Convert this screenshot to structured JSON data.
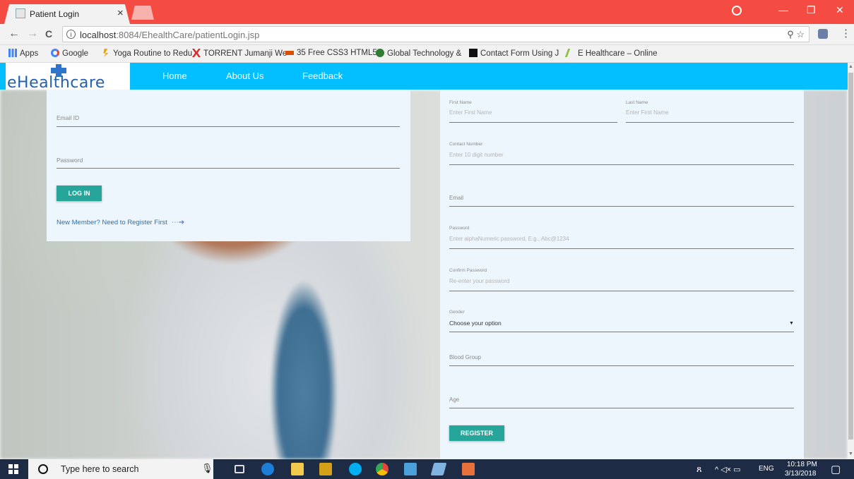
{
  "browser": {
    "tab_title": "Patient Login",
    "tab_close": "×",
    "url_host": "localhost",
    "url_rest": ":8084/EhealthCare/patientLogin.jsp",
    "back": "←",
    "forward": "→",
    "reload": "C",
    "info": "i",
    "omni_icons": "⚲ ☆",
    "menu": "⋮",
    "minimize": "—",
    "restore": "❐",
    "close": "✕"
  },
  "bookmarks": [
    {
      "label": "Apps",
      "icon": "apps-grid-icon",
      "color": "#4285f4"
    },
    {
      "label": "Google",
      "icon": "google-icon",
      "color": "#4285f4"
    },
    {
      "label": "Yoga Routine to Redu",
      "icon": "yoga-icon",
      "color": "#f4a300"
    },
    {
      "label": "TORRENT Jumanji We",
      "icon": "torrent-icon",
      "color": "#d32f2f"
    },
    {
      "label": "35 Free CSS3 HTML5",
      "icon": "css-icon",
      "color": "#d94f00"
    },
    {
      "label": "Global Technology &",
      "icon": "globe-icon",
      "color": "#2e7d32"
    },
    {
      "label": "Contact Form Using J",
      "icon": "jp-icon",
      "color": "#111111"
    },
    {
      "label": "E Healthcare – Online",
      "icon": "leaf-icon",
      "color": "#8bc34a"
    }
  ],
  "site": {
    "logo_text": "eHealthcare",
    "nav": [
      "Home",
      "About Us",
      "Feedback"
    ],
    "brand_color": "#03bfff"
  },
  "login": {
    "email_label": "Email ID",
    "password_label": "Password",
    "login_button": "LOG IN",
    "register_link": "New Member? Need to Register First",
    "arrow": "⋯➔"
  },
  "register": {
    "first_name_label": "First Name",
    "first_name_placeholder": "Enter First Name",
    "last_name_label": "Last Name",
    "last_name_placeholder": "Enter First Name",
    "contact_label": "Contact Number",
    "contact_placeholder": "Enter 10 digit number",
    "email_label": "Email",
    "password_label": "Password",
    "password_placeholder": "Enter alphaNumeric password, E.g., Abc@1234",
    "confirm_label": "Confirm Password",
    "confirm_placeholder": "Re-enter your password",
    "gender_label": "Gender",
    "gender_value": "Choose your option",
    "gender_caret": "▼",
    "blood_label": "Blood Group",
    "age_label": "Age",
    "register_button": "REGISTER"
  },
  "taskbar": {
    "search_text": "Type here to search",
    "mic": "🎙",
    "tray_people": "ጸ",
    "tray_icons": "^  ◁×  ▭",
    "language": "ENG",
    "time": "10:18 PM",
    "date": "3/13/2018",
    "notification": "▢",
    "apps": [
      {
        "name": "task-view-icon",
        "color": "#1e2b45"
      },
      {
        "name": "edge-icon",
        "color": "#1c7ed6"
      },
      {
        "name": "file-explorer-icon",
        "color": "#f2c94c"
      },
      {
        "name": "media-player-icon",
        "color": "#d4a017"
      },
      {
        "name": "skype-icon",
        "color": "#00aff0"
      },
      {
        "name": "chrome-icon",
        "color": "#e8453c"
      },
      {
        "name": "virtualbox-icon",
        "color": "#4aa0d8"
      },
      {
        "name": "notepad-icon",
        "color": "#7fb3e0"
      },
      {
        "name": "presentation-icon",
        "color": "#e8703a"
      }
    ]
  }
}
